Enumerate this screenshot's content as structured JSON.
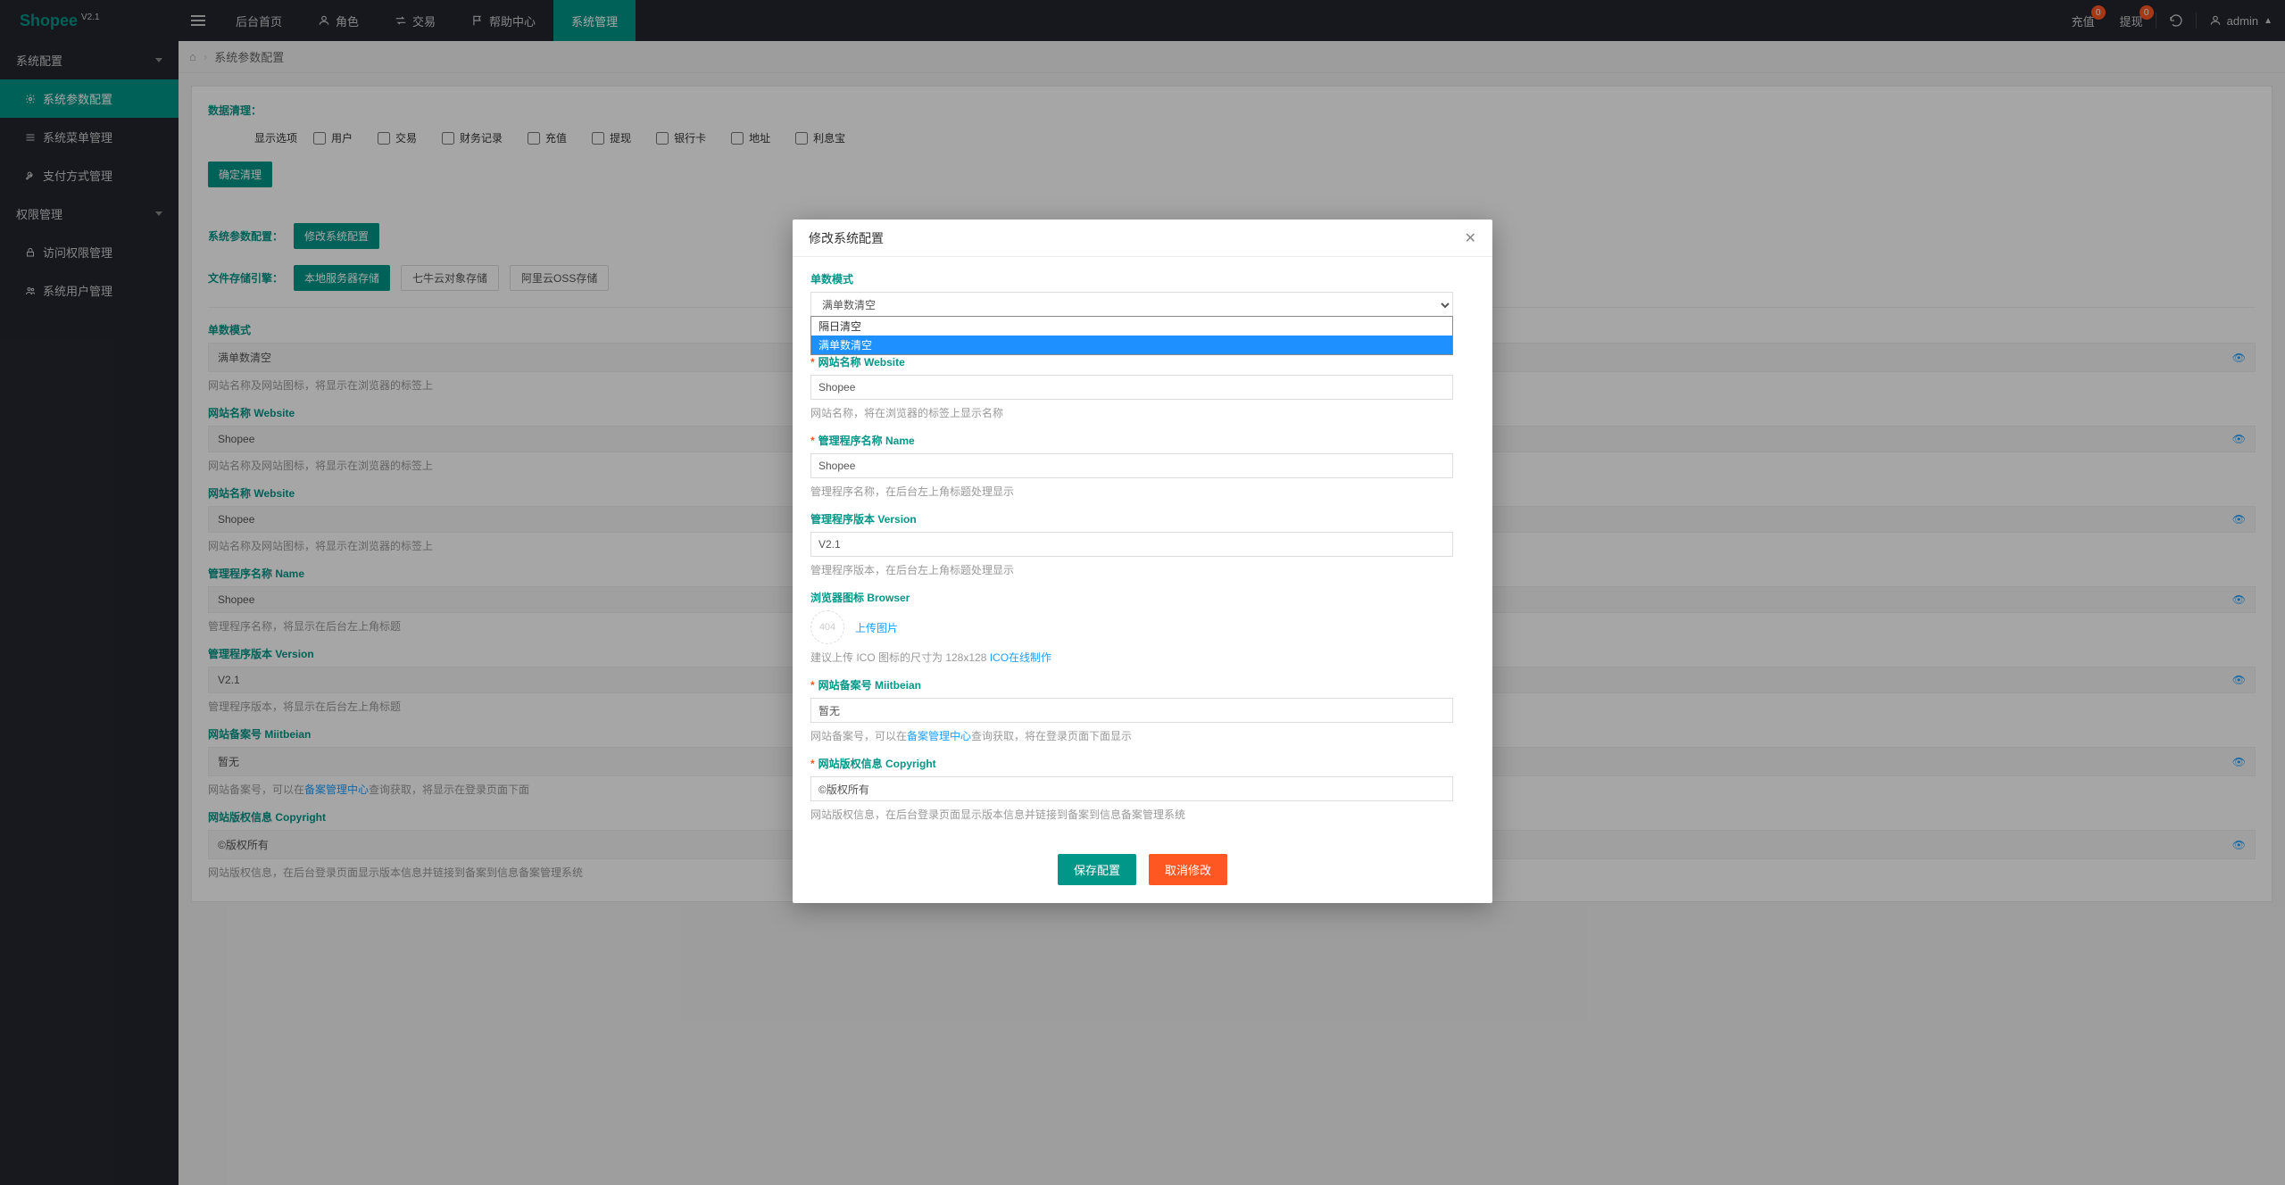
{
  "brand": {
    "name": "Shopee",
    "version": "V2.1"
  },
  "topnav": {
    "items": [
      {
        "label": "后台首页",
        "icon": "home"
      },
      {
        "label": "角色",
        "icon": "user"
      },
      {
        "label": "交易",
        "icon": "exchange"
      },
      {
        "label": "帮助中心",
        "icon": "flag"
      },
      {
        "label": "系统管理",
        "icon": "",
        "active": true
      }
    ],
    "right": {
      "recharge": {
        "label": "充值",
        "badge": "0"
      },
      "withdraw": {
        "label": "提现",
        "badge": "0"
      },
      "user": "admin"
    }
  },
  "sidebar": {
    "system_config": {
      "label": "系统配置"
    },
    "items1": [
      {
        "label": "系统参数配置",
        "icon": "gear",
        "active": true
      },
      {
        "label": "系统菜单管理",
        "icon": "menu"
      },
      {
        "label": "支付方式管理",
        "icon": "pay"
      }
    ],
    "perm": {
      "label": "权限管理"
    },
    "items2": [
      {
        "label": "访问权限管理",
        "icon": "lock"
      },
      {
        "label": "系统用户管理",
        "icon": "users"
      }
    ]
  },
  "breadcrumb": {
    "title": "系统参数配置"
  },
  "page": {
    "cleanup": {
      "title": "数据清理：",
      "display_label": "显示选项",
      "options": [
        "用户",
        "交易",
        "财务记录",
        "充值",
        "提现",
        "银行卡",
        "地址",
        "利息宝"
      ],
      "confirm_btn": "确定清理"
    },
    "system_param": {
      "label": "系统参数配置：",
      "button": "修改系统配置"
    },
    "storage": {
      "label": "文件存储引擎：",
      "options": [
        "本地服务器存储",
        "七牛云对象存储",
        "阿里云OSS存储"
      ],
      "active_index": 0
    },
    "config_items": [
      {
        "label": "单数模式",
        "value": "满单数清空",
        "hint": "网站名称及网站图标，将显示在浏览器的标签上"
      },
      {
        "label": "网站名称 Website",
        "value": "Shopee",
        "hint": "网站名称及网站图标，将显示在浏览器的标签上"
      },
      {
        "label": "网站名称 Website",
        "value": "Shopee",
        "hint": "网站名称及网站图标，将显示在浏览器的标签上"
      },
      {
        "label": "管理程序名称 Name",
        "value": "Shopee",
        "hint": "管理程序名称，将显示在后台左上角标题"
      },
      {
        "label": "管理程序版本 Version",
        "value": "V2.1",
        "hint": "管理程序版本，将显示在后台左上角标题"
      },
      {
        "label": "网站备案号 Miitbeian",
        "value": "暂无",
        "hint_pre": "网站备案号，可以在",
        "hint_link": "备案管理中心",
        "hint_post": "查询获取，将显示在登录页面下面"
      },
      {
        "label": "网站版权信息 Copyright",
        "value": "©版权所有",
        "hint": "网站版权信息，在后台登录页面显示版本信息并链接到备案到信息备案管理系统"
      }
    ]
  },
  "modal": {
    "title": "修改系统配置",
    "fields": {
      "mode": {
        "label": "单数模式",
        "selected": "满单数清空",
        "options": [
          "隔日清空",
          "满单数清空"
        ]
      },
      "website": {
        "label": "网站名称 Website",
        "value": "Shopee",
        "hint": "网站名称，将在浏览器的标签上显示名称",
        "required": true
      },
      "name": {
        "label": "管理程序名称 Name",
        "value": "Shopee",
        "hint": "管理程序名称，在后台左上角标题处理显示",
        "required": true
      },
      "version": {
        "label": "管理程序版本 Version",
        "value": "V2.1",
        "hint": "管理程序版本，在后台左上角标题处理显示"
      },
      "browser": {
        "label": "浏览器图标 Browser",
        "upload_text": "上传图片",
        "placeholder_404": "404",
        "hint_pre": "建议上传 ICO 图标的尺寸为 128x128 ",
        "hint_link": "ICO在线制作"
      },
      "miitbeian": {
        "label": "网站备案号 Miitbeian",
        "value": "暂无",
        "required": true,
        "hint_pre": "网站备案号，可以在",
        "hint_link": "备案管理中心",
        "hint_post": "查询获取，将在登录页面下面显示"
      },
      "copyright": {
        "label": "网站版权信息 Copyright",
        "value": "©版权所有",
        "required": true,
        "hint": "网站版权信息，在后台登录页面显示版本信息并链接到备案到信息备案管理系统"
      }
    },
    "save_btn": "保存配置",
    "cancel_btn": "取消修改"
  }
}
